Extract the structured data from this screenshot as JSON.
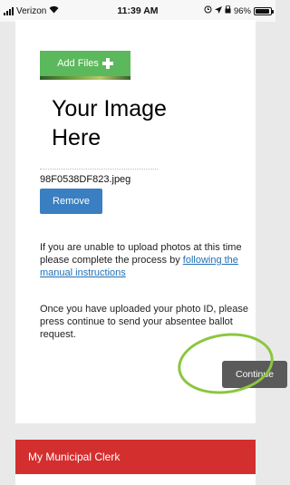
{
  "status_bar": {
    "carrier": "Verizon",
    "time": "11:39 AM",
    "battery_text": "96%",
    "battery_level": 0.96
  },
  "upload": {
    "add_files_label": "Add Files",
    "image_placeholder_line1": "Your Image",
    "image_placeholder_line2": "Here",
    "file_name": "98F0538DF823.jpeg",
    "remove_label": "Remove"
  },
  "instructions": {
    "unable_text": "If you are unable to upload photos at this time please complete the process by",
    "manual_link": "following the manual instructions",
    "continue_text": "Once you have uploaded your photo ID, please press continue to send your absentee ballot request."
  },
  "actions": {
    "continue_label": "Continue"
  },
  "section": {
    "clerk_title": "My Municipal Clerk"
  },
  "colors": {
    "add_files": "#5cb85c",
    "remove": "#3a7fc1",
    "continue": "#5a5a5a",
    "highlight": "#8cc63f",
    "clerk_bar": "#d32f2f"
  },
  "icons": {
    "wifi": "wifi-icon",
    "plus": "plus-icon",
    "location": "location-icon",
    "alarm": "alarm-icon"
  }
}
